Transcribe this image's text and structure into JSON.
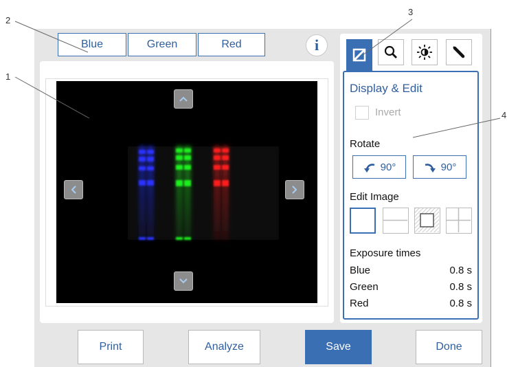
{
  "callouts": [
    "1",
    "2",
    "3",
    "4"
  ],
  "channels": [
    {
      "label": "Blue"
    },
    {
      "label": "Green"
    },
    {
      "label": "Red"
    }
  ],
  "info_label": "i",
  "nav": {
    "up": "up-arrow",
    "down": "down-arrow",
    "left": "left-arrow",
    "right": "right-arrow"
  },
  "tools": [
    "display-edit-icon",
    "zoom-icon",
    "brightness-icon",
    "color-picker-icon"
  ],
  "panel": {
    "title": "Display & Edit",
    "invert_label": "Invert",
    "invert_checked": false,
    "rotate_label": "Rotate",
    "rotate_left": "90°",
    "rotate_right": "90°",
    "edit_image_label": "Edit Image",
    "exposure_title": "Exposure times",
    "exposures": [
      {
        "channel": "Blue",
        "value": "0.8 s"
      },
      {
        "channel": "Green",
        "value": "0.8 s"
      },
      {
        "channel": "Red",
        "value": "0.8 s"
      }
    ]
  },
  "actions": {
    "print": "Print",
    "analyze": "Analyze",
    "save": "Save",
    "done": "Done"
  },
  "colors": {
    "accent": "#3a6fb4",
    "blue_band": "#1f2cff",
    "green_band": "#19e019",
    "red_band": "#ff1a1a"
  }
}
